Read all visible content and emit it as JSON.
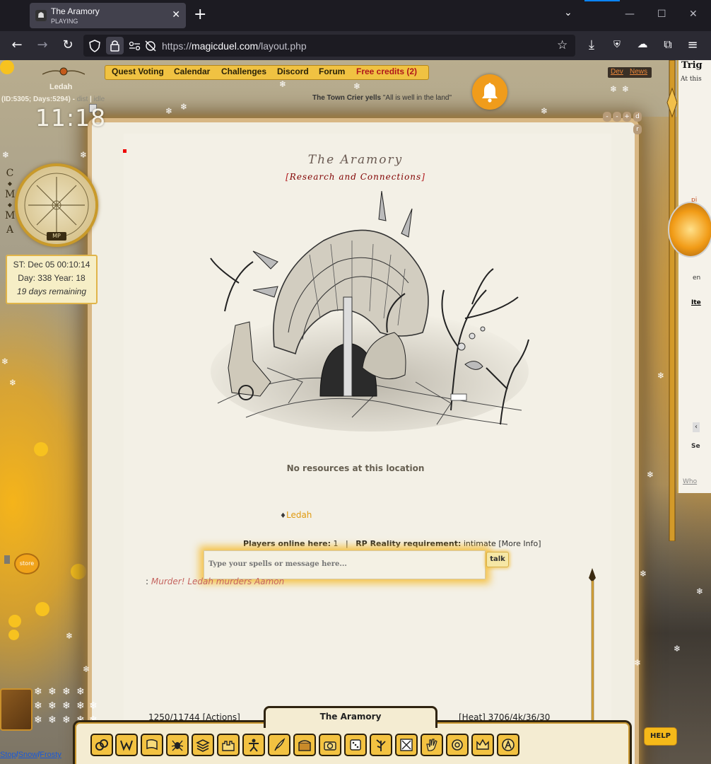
{
  "browser": {
    "tab_title": "The Aramory",
    "tab_subtitle": "PLAYING",
    "url": "https://magicduel.com/layout.php",
    "url_prefix": "https://",
    "url_host": "magicduel.com",
    "url_path": "/layout.php"
  },
  "nav": {
    "items": [
      "Quest Voting",
      "Calendar",
      "Challenges",
      "Discord",
      "Forum",
      "Free credits (2)"
    ],
    "dev": "Dev",
    "news": "News"
  },
  "crier": {
    "speaker": "The Town Crier yells",
    "message": "\"All is well in the land\""
  },
  "player": {
    "name": "Ledah",
    "id_line": "(ID:5305; Days:5294) -",
    "status_a": "dist",
    "status_b": "idle",
    "clock": "11:18",
    "cmma": [
      "C",
      "M",
      "M",
      "A"
    ],
    "mp_badge": "MP"
  },
  "date": {
    "st": "ST: Dec 05 00:10:14",
    "day_year": "Day: 338 Year: 18",
    "remaining": "19 days remaining"
  },
  "location": {
    "title": "The Aramory",
    "subtitle_open": "[",
    "subtitle": "Research and Connections",
    "subtitle_close": "]",
    "resources": "No resources at this location"
  },
  "players_here": {
    "player": "Ledah",
    "online_label": "Players online here:",
    "online_count": "1",
    "separator": "|",
    "rp_label": "RP Reality requirement:",
    "rp_value": "intimate",
    "more_info": "[More Info]"
  },
  "chat": {
    "placeholder": "Type your spells or message here...",
    "talk_label": "talk",
    "log_prefix": ":",
    "log_message": "Murder! Ledah murders Aamon"
  },
  "toolbar": {
    "title": "The Aramory",
    "actions": "1250/11744 [Actions]",
    "heat": "[Heat] 3706/4k/36/30",
    "help": "HELP",
    "store": "store",
    "tools": [
      "rings-icon",
      "w-rune-icon",
      "flag-icon",
      "spider-icon",
      "stack-icon",
      "castle-icon",
      "figure-icon",
      "quill-icon",
      "chest-icon",
      "camera-icon",
      "dice-icon",
      "tree-icon",
      "map-icon",
      "hand-icon",
      "coin-icon",
      "crown-icon",
      "a-badge-icon"
    ]
  },
  "footer_links": {
    "stop": "Stop",
    "snow": "Snow",
    "frosty": "Frosty",
    "sep": "/"
  },
  "window_controls": [
    "-",
    "-",
    "+",
    "d",
    "r"
  ],
  "right_panel": {
    "title": "Trig",
    "subtitle": "At this",
    "label_en": "en",
    "label_ite": "Ite",
    "label_se": "Se",
    "label_who": "Who",
    "label_pi": "pi"
  },
  "colors": {
    "accent_gold": "#f0c242",
    "bell_orange": "#f09c1b",
    "subtitle_red": "#b0171b",
    "player_orange": "#e09a10",
    "murder_red": "#c56560"
  }
}
